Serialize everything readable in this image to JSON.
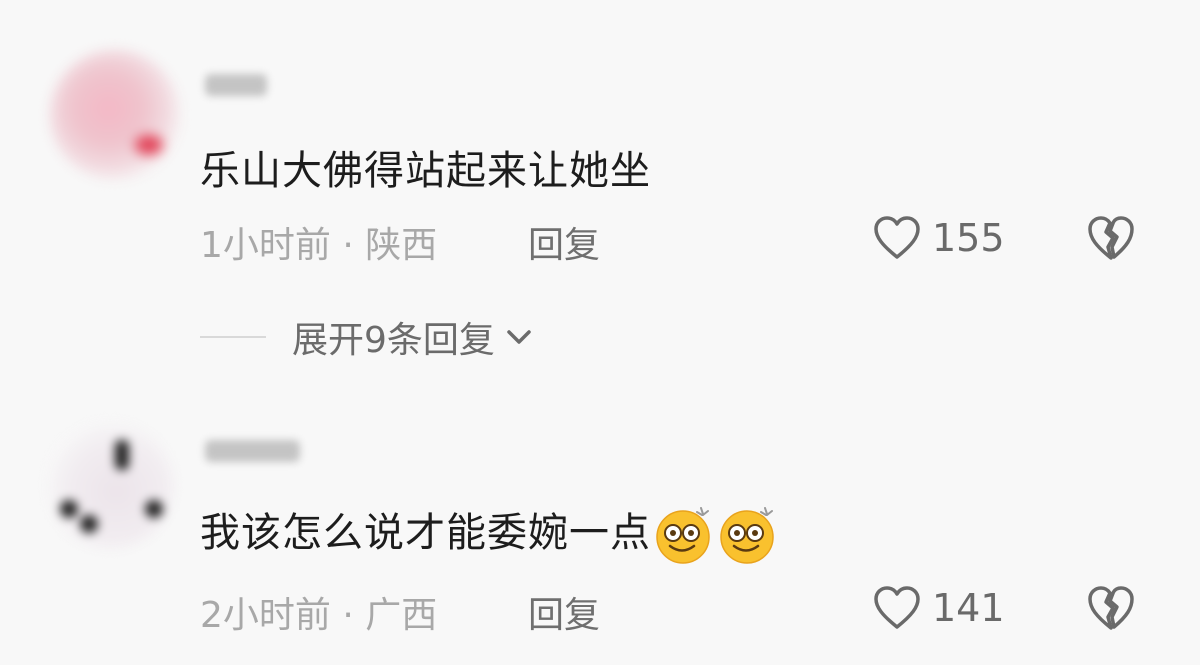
{
  "comments": [
    {
      "text": "乐山大佛得站起来让她坐",
      "time_location": "1小时前 · 陕西",
      "reply_label": "回复",
      "like_count": "155",
      "expand_replies_label": "展开9条回复"
    },
    {
      "text": "我该怎么说才能委婉一点",
      "emoji_count": 2,
      "emoji_icon": "dizzy-smile-emoji",
      "time_location": "2小时前 · 广西",
      "reply_label": "回复",
      "like_count": "141"
    }
  ],
  "icons": {
    "like": "heart-outline-icon",
    "dislike": "broken-heart-icon",
    "expand": "chevron-down-icon"
  },
  "colors": {
    "text_primary": "#1d1d1d",
    "text_meta": "#a8a8a8",
    "icon_gray": "#6a6a6a",
    "emoji_yellow": "#f9c12e"
  }
}
